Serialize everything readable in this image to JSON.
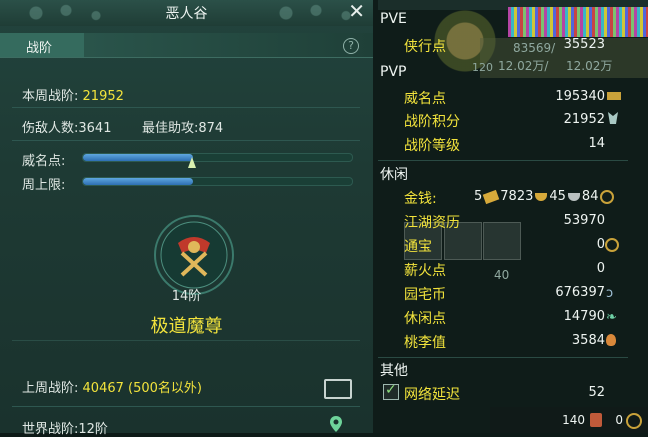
{
  "window": {
    "title": "恶人谷",
    "tab": "战阶"
  },
  "left": {
    "weekly_rank_label": "本周战阶:",
    "weekly_rank_value": "21952",
    "kills_label": "伤敌人数:",
    "kills_value": "3641",
    "assist_label": "最佳助攻:",
    "assist_value": "874",
    "prestige_label": "威名点:",
    "prestige_progress": 0.41,
    "weekly_cap_label": "周上限:",
    "weekly_cap_progress": 0.41,
    "rank_level": "14阶",
    "rank_name": "极道魔尊",
    "last_week_label": "上周战阶:",
    "last_week_value": "40467 (500名以外)",
    "world_rank_label": "世界战阶:",
    "world_rank_value": "12阶"
  },
  "right": {
    "overlay_numbers": [
      "83569/",
      "12.02万/",
      "12.02万",
      "120"
    ],
    "bg_numbers": [
      "40"
    ],
    "pve": {
      "title": "PVE",
      "items": [
        {
          "label": "侠行点",
          "value": "35523"
        }
      ]
    },
    "pvp": {
      "title": "PVP",
      "items": [
        {
          "label": "威名点",
          "value": "195340"
        },
        {
          "label": "战阶积分",
          "value": "21952"
        },
        {
          "label": "战阶等级",
          "value": "14"
        }
      ]
    },
    "leisure": {
      "title": "休闲",
      "items": [
        {
          "label": "金钱:",
          "value": "5"
        },
        {
          "label": "江湖资历",
          "value": "53970"
        },
        {
          "label": "通宝",
          "value": "0"
        },
        {
          "label": "薪火点",
          "value": "0"
        },
        {
          "label": "园宅币",
          "value": "676397"
        },
        {
          "label": "休闲点",
          "value": "14790"
        },
        {
          "label": "桃李值",
          "value": "3584"
        }
      ],
      "money_parts": [
        "7823",
        "45",
        "84"
      ]
    },
    "other": {
      "title": "其他",
      "latency_label": "网络延迟",
      "latency_value": "52"
    },
    "bottom": {
      "count1": "140",
      "count2": "0"
    }
  },
  "colors": {
    "accent_yellow": "#f2e33c",
    "bar_blue": "#3d86cc",
    "panel_green": "#22443d"
  }
}
